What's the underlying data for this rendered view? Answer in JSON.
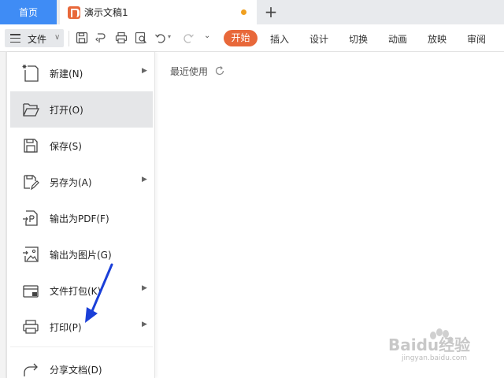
{
  "tabs": {
    "home_label": "首页",
    "document_title": "演示文稿1",
    "new_tab_symbol": "+"
  },
  "ribbon": {
    "file_label": "文件",
    "active_tab": "开始",
    "tabs": [
      "插入",
      "设计",
      "切换",
      "动画",
      "放映",
      "审阅"
    ]
  },
  "file_menu": {
    "items": [
      {
        "label": "新建(N)",
        "icon": "new-file-icon",
        "submenu": true
      },
      {
        "label": "打开(O)",
        "icon": "folder-open-icon",
        "submenu": false
      },
      {
        "label": "保存(S)",
        "icon": "save-icon",
        "submenu": false
      },
      {
        "label": "另存为(A)",
        "icon": "save-as-icon",
        "submenu": true
      },
      {
        "label": "输出为PDF(F)",
        "icon": "export-pdf-icon",
        "submenu": false
      },
      {
        "label": "输出为图片(G)",
        "icon": "export-image-icon",
        "submenu": false
      },
      {
        "label": "文件打包(K)",
        "icon": "package-icon",
        "submenu": true
      },
      {
        "label": "打印(P)",
        "icon": "printer-icon",
        "submenu": true
      },
      {
        "label": "分享文档(D)",
        "icon": "share-icon",
        "submenu": false
      }
    ],
    "hovered_index": 1
  },
  "recent": {
    "title": "最近使用"
  },
  "watermark": {
    "text": "Baidu经验",
    "sub": "jingyan.baidu.com"
  },
  "colors": {
    "accent_orange": "#e8683a",
    "home_blue": "#3f8cf5",
    "annotation_arrow": "#1a3fd8",
    "modified_dot": "#f0a020"
  }
}
